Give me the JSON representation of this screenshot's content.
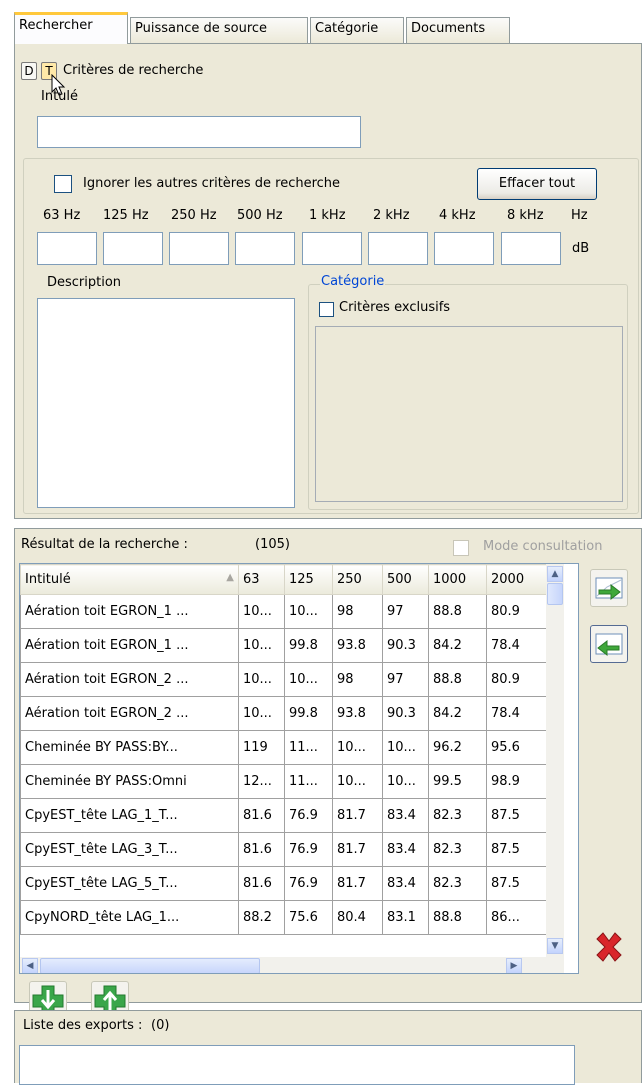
{
  "tabs": [
    "Rechercher",
    "Puissance de source",
    "Catégorie",
    "Documents"
  ],
  "search": {
    "d_label": "D",
    "t_label": "T",
    "criteria_title": "Critères de recherche",
    "intitule_label": "Intulé",
    "intitule_value": "",
    "ignore_label": "Ignorer les autres critères de recherche",
    "clear_all": "Effacer tout",
    "freqs": [
      "63 Hz",
      "125 Hz",
      "250 Hz",
      "500 Hz",
      "1 kHz",
      "2 kHz",
      "4 kHz",
      "8 kHz"
    ],
    "unit_hz": "Hz",
    "unit_db": "dB",
    "description_label": "Description",
    "category_group": "Catégorie",
    "exclusive_label": "Critères exclusifs"
  },
  "results": {
    "title": "Résultat de la recherche :",
    "count": "(105)",
    "mode_label": "Mode consultation",
    "columns": [
      "Intitulé",
      "63",
      "125",
      "250",
      "500",
      "1000",
      "2000"
    ],
    "rows": [
      [
        "Aération toit EGRON_1 ...",
        "10...",
        "10...",
        "98",
        "97",
        "88.8",
        "80.9"
      ],
      [
        "Aération toit EGRON_1 ...",
        "10...",
        "99.8",
        "93.8",
        "90.3",
        "84.2",
        "78.4"
      ],
      [
        "Aération toit EGRON_2 ...",
        "10...",
        "10...",
        "98",
        "97",
        "88.8",
        "80.9"
      ],
      [
        "Aération toit EGRON_2 ...",
        "10...",
        "99.8",
        "93.8",
        "90.3",
        "84.2",
        "78.4"
      ],
      [
        "Cheminée BY PASS:BY...",
        "119",
        "11...",
        "10...",
        "10...",
        "96.2",
        "95.6"
      ],
      [
        "Cheminée BY PASS:Omni",
        "12...",
        "11...",
        "10...",
        "10...",
        "99.5",
        "98.9"
      ],
      [
        "CpyEST_tête LAG_1_T...",
        "81.6",
        "76.9",
        "81.7",
        "83.4",
        "82.3",
        "87.5"
      ],
      [
        "CpyEST_tête LAG_3_T...",
        "81.6",
        "76.9",
        "81.7",
        "83.4",
        "82.3",
        "87.5"
      ],
      [
        "CpyEST_tête LAG_5_T...",
        "81.6",
        "76.9",
        "81.7",
        "83.4",
        "82.3",
        "87.5"
      ],
      [
        "CpyNORD_tête LAG_1...",
        "88.2",
        "75.6",
        "80.4",
        "83.1",
        "88.8",
        "86..."
      ]
    ]
  },
  "exports": {
    "title": "Liste des exports :",
    "count": "(0)"
  }
}
